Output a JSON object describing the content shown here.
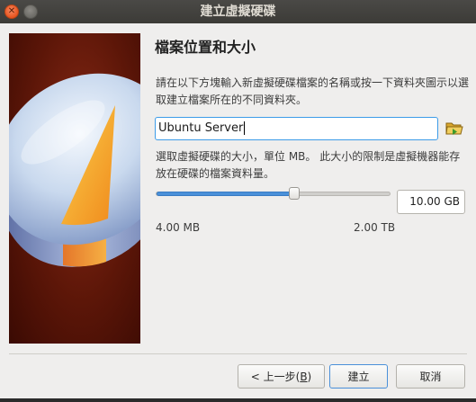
{
  "window": {
    "title": "建立虛擬硬碟",
    "close_glyph": "✕"
  },
  "page": {
    "title": "檔案位置和大小",
    "description_location": "請在以下方塊輸入新虛擬硬碟檔案的名稱或按一下資料夾圖示以選取建立檔案所在的不同資料夾。",
    "description_size": "選取虛擬硬碟的大小，單位 MB。 此大小的限制是虛擬機器能存放在硬碟的檔案資料量。"
  },
  "file_name": {
    "value": "Ubuntu Server"
  },
  "folder_button": {
    "icon": "folder-open-icon"
  },
  "size": {
    "value": "10.00 GB",
    "slider_fraction": 0.59,
    "min_label": "4.00 MB",
    "max_label": "2.00 TB"
  },
  "buttons": {
    "back_prefix": "< 上一步(",
    "back_mnemonic": "B",
    "back_suffix": ")",
    "create": "建立",
    "cancel": "取消"
  },
  "colors": {
    "accent": "#4a90d9",
    "titlebar": "#3c3b37",
    "close_button": "#e9541f"
  }
}
